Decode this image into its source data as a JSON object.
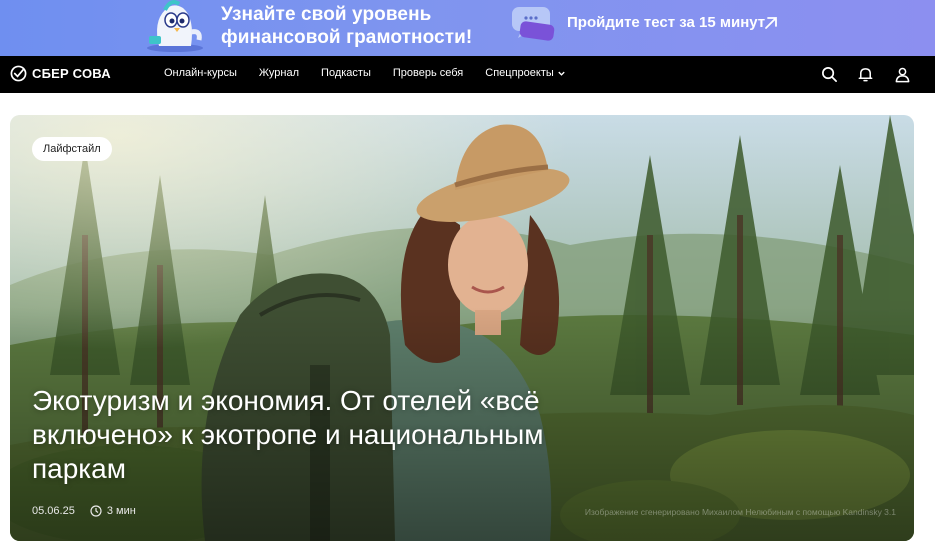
{
  "promo": {
    "headline_line1": "Узнайте свой уровень",
    "headline_line2": "финансовой грамотности!",
    "cta": "Пройдите тест за 15 минут",
    "background": "#7b94ef"
  },
  "nav": {
    "logo": "СБЕР СОВА",
    "items": [
      {
        "label": "Онлайн-курсы"
      },
      {
        "label": "Журнал"
      },
      {
        "label": "Подкасты"
      },
      {
        "label": "Проверь себя"
      },
      {
        "label": "Спецпроекты"
      }
    ],
    "icons": [
      "search-icon",
      "bell-icon",
      "user-icon"
    ]
  },
  "hero": {
    "tag": "Лайфстайл",
    "title": "Экотуризм и экономия. От отелей «всё включено» к экотропе и национальным паркам",
    "date": "05.06.25",
    "read_time": "3 мин",
    "image_credit": "Изображение сгенерировано Михаилом Нелюбиным с помощью Kandinsky 3.1"
  }
}
